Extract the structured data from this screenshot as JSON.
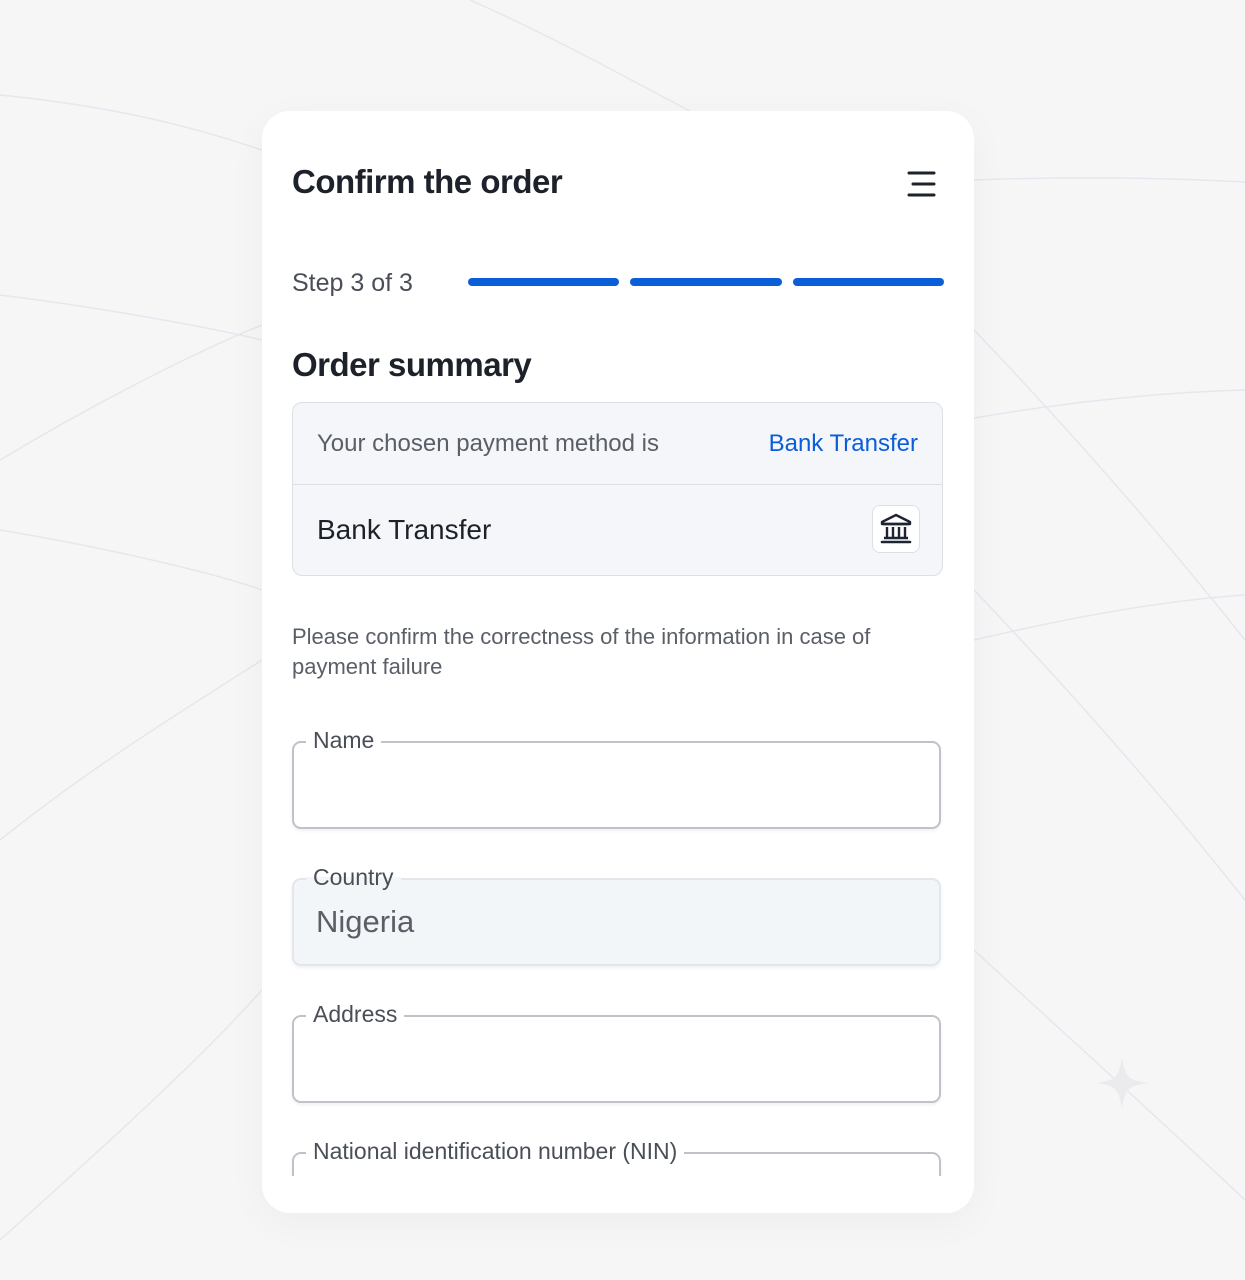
{
  "header": {
    "title": "Confirm the order",
    "menu_icon": "menu-icon"
  },
  "progress": {
    "label": "Step 3 of 3",
    "current_step": 3,
    "total_steps": 3,
    "color": "#0a5ed7"
  },
  "summary": {
    "title": "Order summary",
    "chosen_label": "Your chosen payment method is",
    "chosen_value": "Bank Transfer",
    "method_name": "Bank Transfer",
    "method_icon": "bank-icon"
  },
  "notice": "Please confirm the correctness of the information in case of payment failure",
  "form": {
    "name": {
      "label": "Name",
      "value": ""
    },
    "country": {
      "label": "Country",
      "value": "Nigeria"
    },
    "address": {
      "label": "Address",
      "value": ""
    },
    "nin": {
      "label": "National identification number (NIN)",
      "value": ""
    }
  }
}
